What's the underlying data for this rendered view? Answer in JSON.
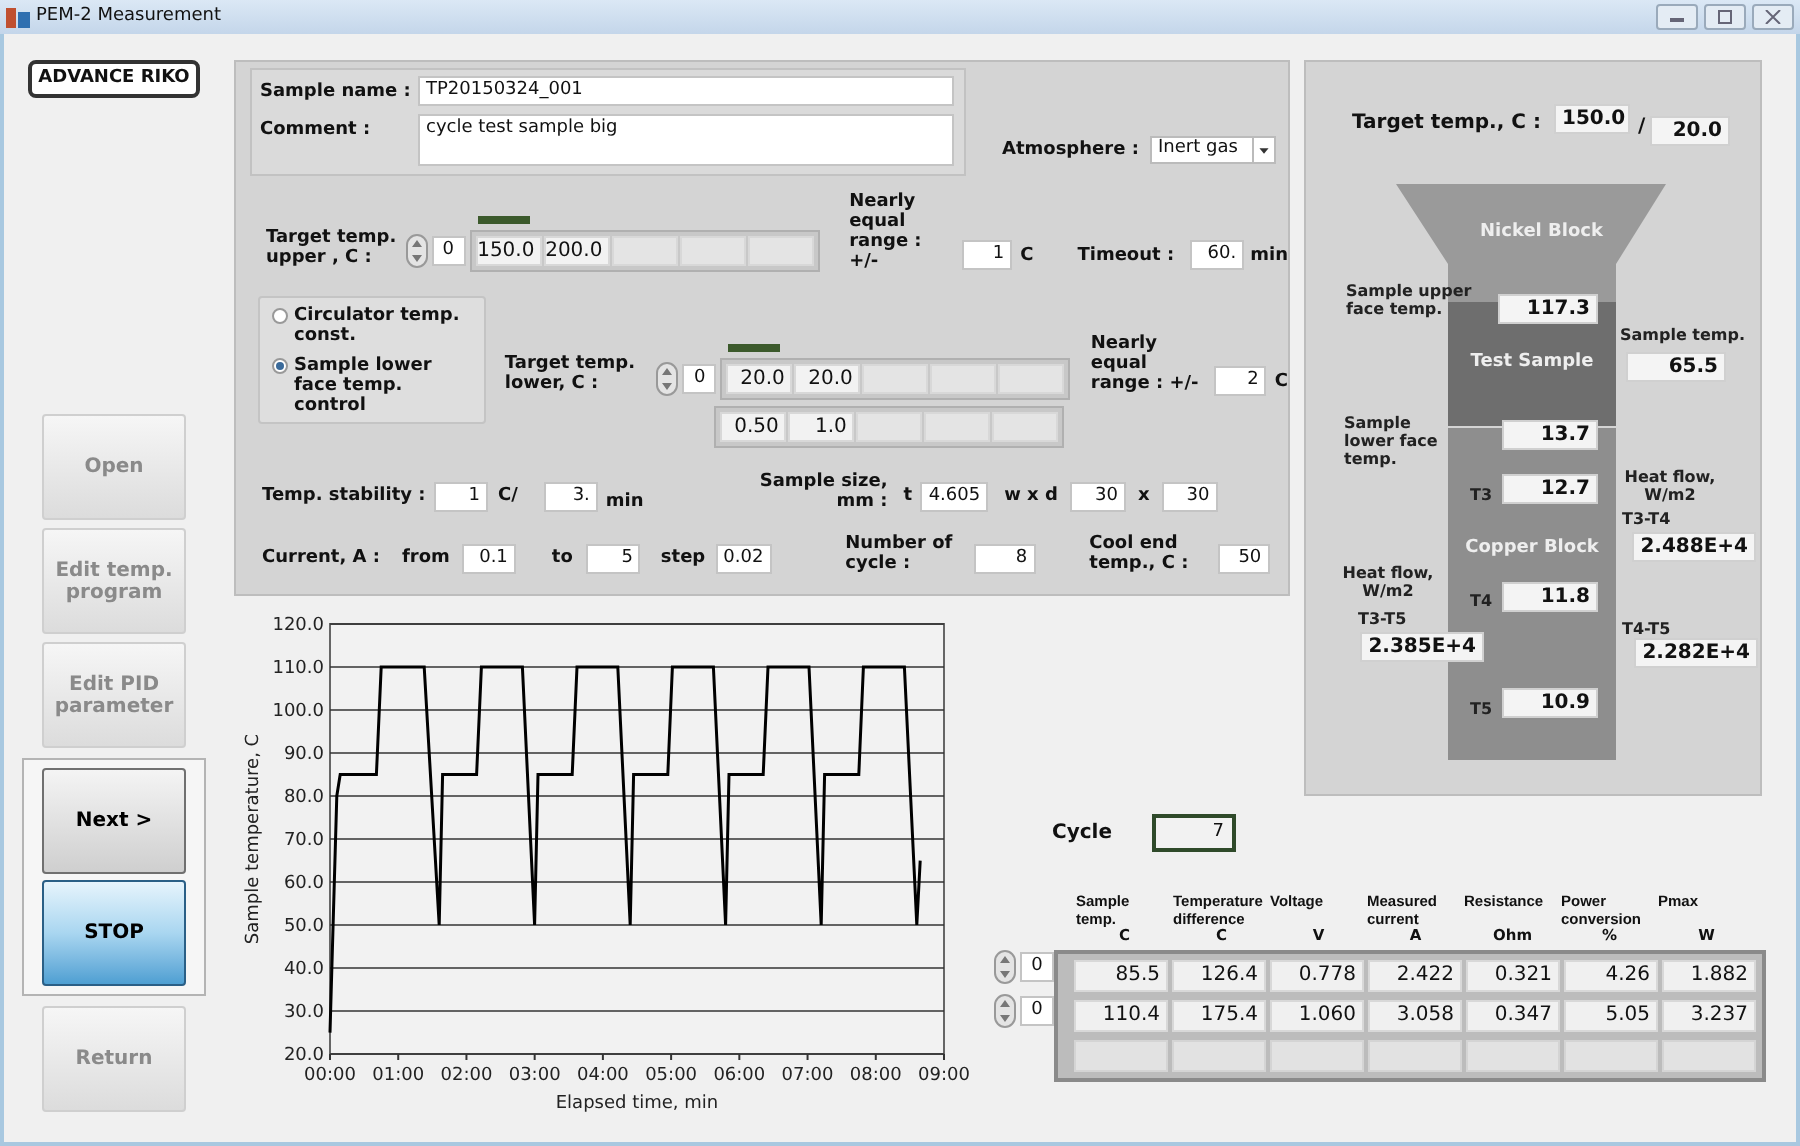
{
  "window": {
    "title": "PEM-2 Measurement"
  },
  "sidebar": {
    "logo": "ADVANCE RIKO",
    "buttons": [
      {
        "label": "Open",
        "kind": "plain",
        "disabled": true
      },
      {
        "label": "Edit temp. program",
        "kind": "plain",
        "disabled": true
      },
      {
        "label": "Edit PID parameter",
        "kind": "plain",
        "disabled": true
      },
      {
        "label": "Next >",
        "kind": "group",
        "disabled": false
      },
      {
        "label": "STOP",
        "kind": "group_stop",
        "disabled": false
      },
      {
        "label": "Return",
        "kind": "plain",
        "disabled": true
      }
    ]
  },
  "settings": {
    "sample_name": {
      "label": "Sample name :",
      "value": "TP20150324_001"
    },
    "comment": {
      "label": "Comment :",
      "value": "cycle test sample big"
    },
    "atmosphere": {
      "label": "Atmosphere :",
      "value": "Inert gas"
    },
    "upper": {
      "label": "Target temp. upper , C :",
      "index": "0",
      "values": [
        "150.0",
        "200.0"
      ]
    },
    "upper_range": {
      "label": "Nearly equal range : +/-",
      "value": "1",
      "unit": "C"
    },
    "timeout": {
      "label": "Timeout :",
      "value": "60.",
      "unit": "min"
    },
    "control_mode": [
      {
        "label": "Circulator temp. const.",
        "selected": false
      },
      {
        "label": "Sample lower face temp. control",
        "selected": true
      }
    ],
    "lower": {
      "label": "Target temp. lower, C :",
      "index": "0",
      "values": [
        "20.0",
        "20.0"
      ],
      "rates": [
        "0.50",
        "1.0"
      ]
    },
    "lower_range": {
      "label": "Nearly equal range : +/-",
      "value": "2",
      "unit": "C"
    },
    "stability": {
      "label": "Temp. stability :",
      "value": "1",
      "unit": "C/",
      "time": "3.",
      "time_unit": "min"
    },
    "sample_size": {
      "label": "Sample size, mm :",
      "t_label": "t",
      "t": "4.605",
      "wd_label": "w x d",
      "w": "30",
      "x_label": "x",
      "d": "30"
    },
    "current": {
      "label": "Current, A :",
      "from_label": "from",
      "from": "0.1",
      "to_label": "to",
      "to": "5",
      "step_label": "step",
      "step": "0.02"
    },
    "cycles": {
      "label": "Number of cycle :",
      "value": "8"
    },
    "cool_end": {
      "label": "Cool end temp., C :",
      "value": "50"
    }
  },
  "monitor": {
    "target": {
      "label": "Target temp., C :",
      "upper": "150.0",
      "separator": "/",
      "lower": "20.0"
    },
    "blocks": {
      "nickel": "Nickel Block",
      "sample": "Test Sample",
      "copper": "Copper Block"
    },
    "upper_face": {
      "label": "Sample upper face temp.",
      "value": "117.3"
    },
    "sample_temp": {
      "label": "Sample temp.",
      "value": "65.5"
    },
    "lower_face": {
      "label": "Sample lower face temp.",
      "value": "13.7"
    },
    "t3": {
      "label": "T3",
      "value": "12.7"
    },
    "t4": {
      "label": "T4",
      "value": "11.8"
    },
    "t5": {
      "label": "T5",
      "value": "10.9"
    },
    "heat_flow_right": {
      "label": "Heat flow, W/m2",
      "pair": "T3-T4",
      "value": "2.488E+4"
    },
    "heat_flow_right_2": {
      "pair": "T4-T5",
      "value": "2.282E+4"
    },
    "heat_flow_left": {
      "label": "Heat flow, W/m2",
      "pair": "T3-T5",
      "value": "2.385E+4"
    }
  },
  "chart": {
    "chart_data": {
      "type": "line",
      "xlabel": "Elapsed time, min",
      "ylabel": "Sample temperature, C",
      "x": [
        0,
        0.1,
        0.15,
        0.68,
        0.75,
        1.38,
        1.6,
        1.65,
        2.15,
        2.22,
        2.82,
        3.0,
        3.05,
        3.55,
        3.62,
        4.22,
        4.4,
        4.45,
        4.95,
        5.02,
        5.62,
        5.8,
        5.85,
        6.35,
        6.42,
        7.02,
        7.2,
        7.25,
        7.75,
        7.82,
        8.42,
        8.6,
        8.65
      ],
      "grid": true,
      "series": [
        {
          "color": "#000000",
          "values": [
            25,
            80,
            85,
            85,
            110,
            110,
            50,
            85,
            85,
            110,
            110,
            50,
            85,
            85,
            110,
            110,
            50,
            85,
            85,
            110,
            110,
            50,
            85,
            85,
            110,
            110,
            50,
            85,
            85,
            110,
            110,
            50,
            65
          ]
        }
      ],
      "xlim": [
        0,
        9
      ],
      "ylim": [
        20,
        120
      ],
      "xticks": [
        {
          "value": 0,
          "label": "00:00"
        },
        {
          "value": 1,
          "label": "01:00"
        },
        {
          "value": 2,
          "label": "02:00"
        },
        {
          "value": 3,
          "label": "03:00"
        },
        {
          "value": 4,
          "label": "04:00"
        },
        {
          "value": 5,
          "label": "05:00"
        },
        {
          "value": 6,
          "label": "06:00"
        },
        {
          "value": 7,
          "label": "07:00"
        },
        {
          "value": 8,
          "label": "08:00"
        },
        {
          "value": 9,
          "label": "09:00"
        }
      ],
      "yticks": [
        {
          "value": 20,
          "label": "20.0"
        },
        {
          "value": 30,
          "label": "30.0"
        },
        {
          "value": 40,
          "label": "40.0"
        },
        {
          "value": 50,
          "label": "50.0"
        },
        {
          "value": 60,
          "label": "60.0"
        },
        {
          "value": 70,
          "label": "70.0"
        },
        {
          "value": 80,
          "label": "80.0"
        },
        {
          "value": 90,
          "label": "90.0"
        },
        {
          "value": 100,
          "label": "100.0"
        },
        {
          "value": 110,
          "label": "110.0"
        },
        {
          "value": 120,
          "label": "120.0"
        }
      ]
    }
  },
  "results": {
    "cycle": {
      "label": "Cycle",
      "value": "7"
    },
    "columns": [
      {
        "name": "Sample temp.",
        "unit": "C"
      },
      {
        "name": "Temperature difference",
        "unit": "C"
      },
      {
        "name": "Voltage",
        "unit": "V"
      },
      {
        "name": "Measured current",
        "unit": "A"
      },
      {
        "name": "Resistance",
        "unit": "Ohm"
      },
      {
        "name": "Power conversion",
        "unit": "%"
      },
      {
        "name": "Pmax",
        "unit": "W"
      }
    ],
    "rows": [
      {
        "index": "0",
        "cells": [
          "85.5",
          "126.4",
          "0.778",
          "2.422",
          "0.321",
          "4.26",
          "1.882"
        ]
      },
      {
        "index": "0",
        "cells": [
          "110.4",
          "175.4",
          "1.060",
          "3.058",
          "0.347",
          "5.05",
          "3.237"
        ]
      }
    ]
  }
}
